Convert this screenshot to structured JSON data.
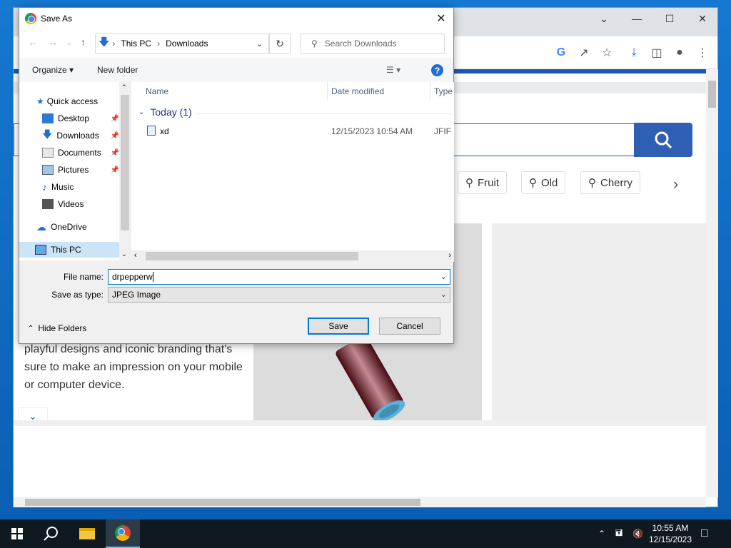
{
  "dialog": {
    "title": "Save As",
    "breadcrumb": [
      "This PC",
      "Downloads"
    ],
    "search_placeholder": "Search Downloads",
    "organize_label": "Organize",
    "new_folder_label": "New folder",
    "nav_items": [
      {
        "label": "Quick access",
        "icon": "star-icon"
      },
      {
        "label": "Desktop",
        "icon": "desktop-icon",
        "pinned": true
      },
      {
        "label": "Downloads",
        "icon": "download-arrow-icon",
        "pinned": true
      },
      {
        "label": "Documents",
        "icon": "documents-icon",
        "pinned": true
      },
      {
        "label": "Pictures",
        "icon": "pictures-icon",
        "pinned": true
      },
      {
        "label": "Music",
        "icon": "music-icon"
      },
      {
        "label": "Videos",
        "icon": "videos-icon"
      },
      {
        "label": "OneDrive",
        "icon": "cloud-icon"
      },
      {
        "label": "This PC",
        "icon": "computer-icon",
        "selected": true
      }
    ],
    "columns": {
      "name": "Name",
      "date_modified": "Date modified",
      "type": "Type"
    },
    "group_label": "Today (1)",
    "files": [
      {
        "name": "xd",
        "date": "12/15/2023 10:54 AM",
        "type": "JFIF F"
      }
    ],
    "file_name_label": "File name:",
    "file_name_value": "drpepperw",
    "save_type_label": "Save as type:",
    "save_type_value": "JPEG Image",
    "save_label": "Save",
    "cancel_label": "Cancel",
    "hide_folders_label": "Hide Folders"
  },
  "page": {
    "chips": [
      "Fruit",
      "Old",
      "Cherry"
    ],
    "description_lines": [
      "playful designs and iconic branding that's",
      "sure to make an impression on your mobile",
      "or computer device."
    ]
  },
  "taskbar": {
    "time": "10:55 AM",
    "date": "12/15/2023"
  },
  "colors": {
    "accent": "#0078d7",
    "brand_blue": "#2f5fb5",
    "taskbar": "#101820"
  }
}
